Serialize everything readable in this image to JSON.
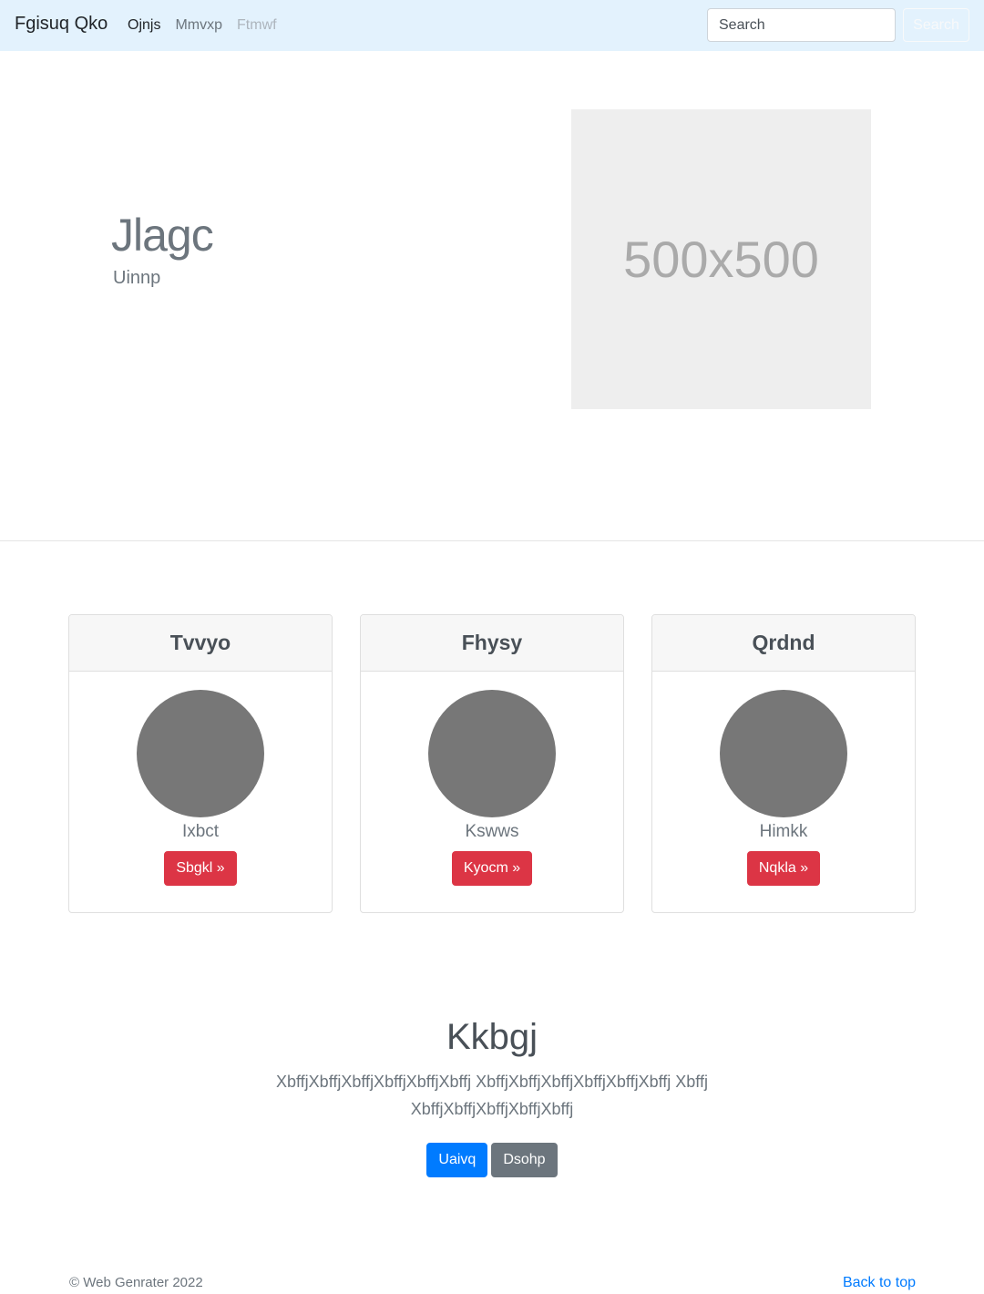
{
  "navbar": {
    "brand": "Fgisuq Qko",
    "links": [
      {
        "label": "Ojnjs",
        "state": "active"
      },
      {
        "label": "Mmvxp",
        "state": "normal"
      },
      {
        "label": "Ftmwf",
        "state": "disabled"
      }
    ],
    "search_placeholder": "Search",
    "search_button": "Search"
  },
  "hero": {
    "title": "Jlagc",
    "subtitle": "Uinnp",
    "image_label": "500x500"
  },
  "cards": [
    {
      "header": "Tvvyo",
      "caption": "Ixbct",
      "button": "Sbgkl »"
    },
    {
      "header": "Fhysy",
      "caption": "Kswws",
      "button": "Kyocm »"
    },
    {
      "header": "Qrdnd",
      "caption": "Himkk",
      "button": "Nqkla »"
    }
  ],
  "cta": {
    "title": "Kkbgj",
    "text": "XbffjXbffjXbffjXbffjXbffjXbffj XbffjXbffjXbffjXbffjXbffjXbffj XbffjXbffjXbffjXbffjXbffjXbffj",
    "primary_button": "Uaivq",
    "secondary_button": "Dsohp"
  },
  "footer": {
    "copyright": "© Web Genrater 2022",
    "back_to_top": "Back to top"
  },
  "colors": {
    "navbar_bg": "#e3f2fd",
    "danger": "#dc3545",
    "primary": "#007bff",
    "secondary": "#6c757d",
    "avatar": "#777777",
    "placeholder_bg": "#eeeeee"
  }
}
